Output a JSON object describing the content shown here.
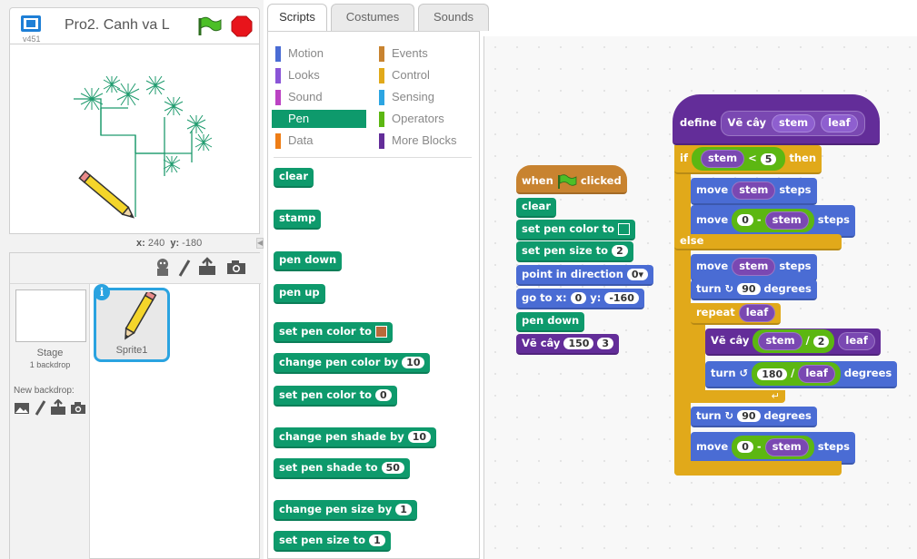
{
  "stage": {
    "title": "Pro2. Canh va L",
    "version": "v451",
    "x_label": "x:",
    "x_value": "240",
    "y_label": "y:",
    "y_value": "-180"
  },
  "sprites": {
    "stage_label": "Stage",
    "stage_sub": "1 backdrop",
    "new_backdrop": "New backdrop:",
    "sprite1": "Sprite1",
    "info_glyph": "i"
  },
  "tabs": {
    "scripts": "Scripts",
    "costumes": "Costumes",
    "sounds": "Sounds"
  },
  "categories": {
    "motion": "Motion",
    "looks": "Looks",
    "sound": "Sound",
    "pen": "Pen",
    "data": "Data",
    "events": "Events",
    "control": "Control",
    "sensing": "Sensing",
    "operators": "Operators",
    "more_blocks": "More Blocks",
    "colors": {
      "motion": "#4a6cd4",
      "looks": "#8a55d7",
      "sound": "#bb42c3",
      "pen": "#0e9a6c",
      "data": "#ee7d16",
      "events": "#c88330",
      "control": "#e1a91a",
      "sensing": "#2ca5e2",
      "operators": "#5cb712",
      "more_blocks": "#632d99"
    }
  },
  "palette": {
    "clear": "clear",
    "stamp": "stamp",
    "pen_down": "pen down",
    "pen_up": "pen up",
    "set_pen_color_to": "set pen color to",
    "change_pen_color_by": "change pen color by",
    "change_pen_color_by_val": "10",
    "set_pen_color_to2": "set pen color to",
    "set_pen_color_to2_val": "0",
    "change_pen_shade_by": "change pen shade by",
    "change_pen_shade_by_val": "10",
    "set_pen_shade_to": "set pen shade to",
    "set_pen_shade_to_val": "50",
    "change_pen_size_by": "change pen size by",
    "change_pen_size_by_val": "1",
    "set_pen_size_to": "set pen size to",
    "set_pen_size_to_val": "1"
  },
  "script_main": {
    "when": "when",
    "clicked": "clicked",
    "clear": "clear",
    "set_pen_color_to": "set pen color to",
    "set_pen_size_to": "set pen size to",
    "set_pen_size_val": "2",
    "point_in_direction": "point in direction",
    "direction_val": "0",
    "go_to_x": "go to x:",
    "x_val": "0",
    "y_lbl": "y:",
    "y_val": "-160",
    "pen_down": "pen down",
    "ve_cay": "Vẽ cây",
    "ve_cay_a": "150",
    "ve_cay_b": "3"
  },
  "script_define": {
    "define": "define",
    "ve_cay": "Vẽ cây",
    "stem": "stem",
    "leaf": "leaf",
    "if": "if",
    "lt": "<",
    "five": "5",
    "then": "then",
    "move": "move",
    "steps": "steps",
    "zero": "0",
    "minus": "-",
    "else": "else",
    "turn": "turn",
    "ninety": "90",
    "degrees": "degrees",
    "repeat": "repeat",
    "div": "/",
    "two": "2",
    "one_eighty": "180"
  }
}
